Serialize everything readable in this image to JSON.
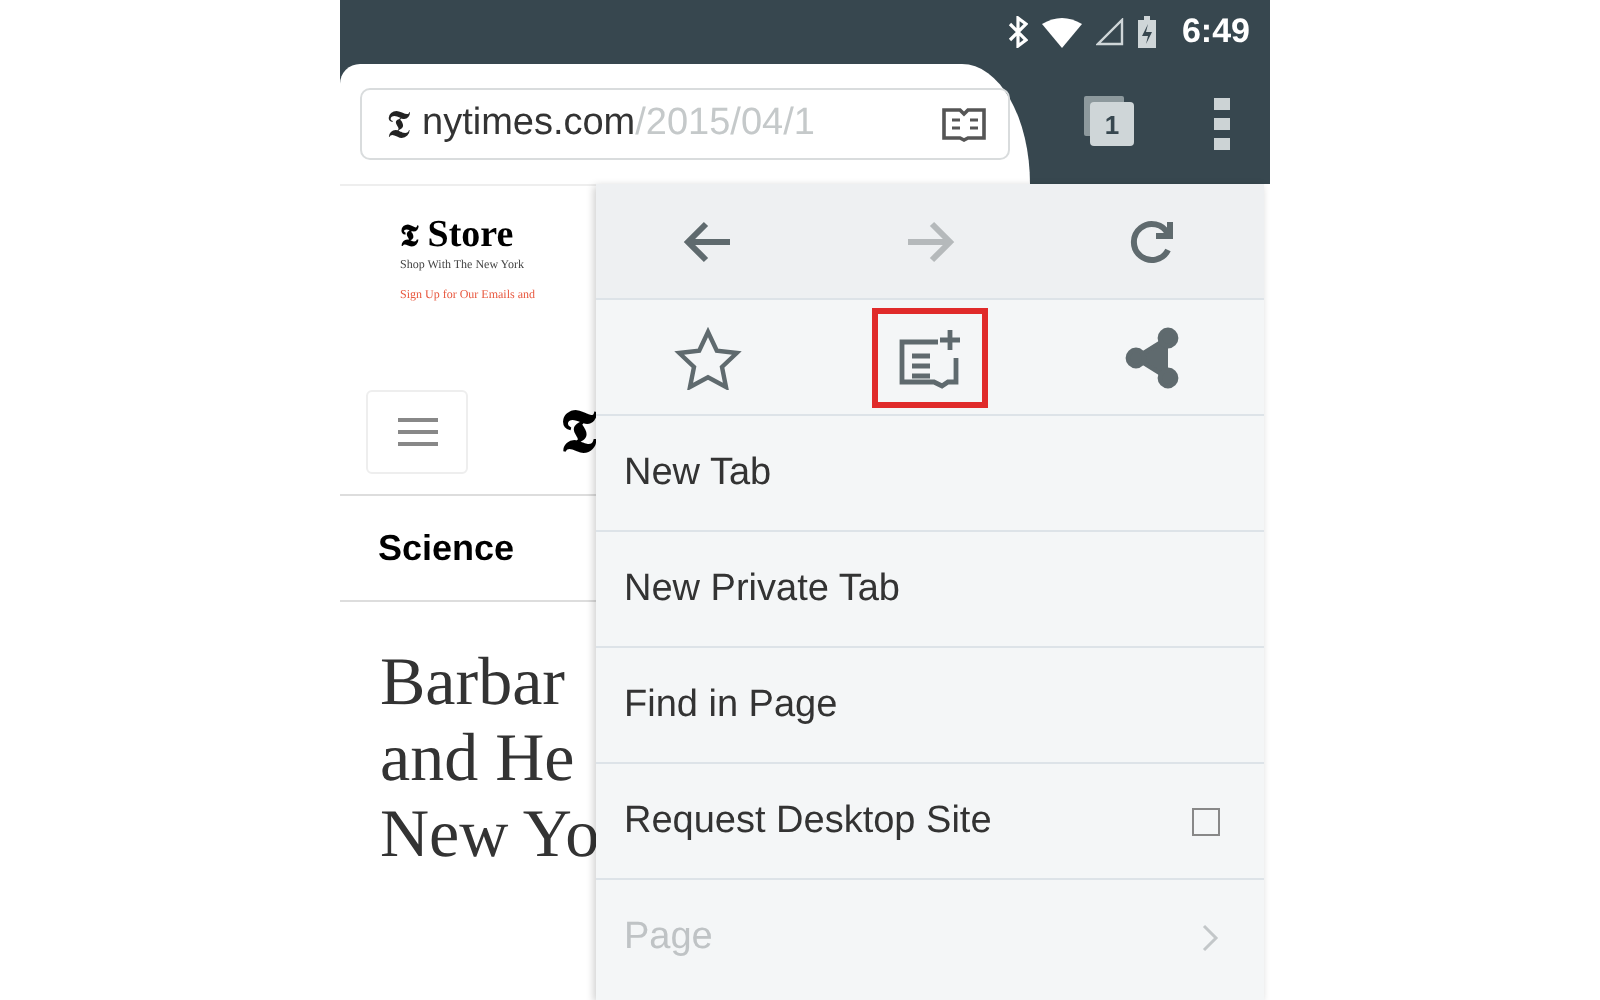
{
  "status_bar": {
    "time": "6:49"
  },
  "address_bar": {
    "logo": "𝕿",
    "domain": "nytimes.com",
    "path": "/2015/04/1"
  },
  "tab_count": "1",
  "page": {
    "store_logo": "𝕿",
    "masthead_logo": "𝕿",
    "store_title": "Store",
    "store_tagline": "Shop With The New York",
    "store_signup": "Sign Up for Our Emails and",
    "section": "Science",
    "headline_lines": [
      "Barbar",
      "and He",
      "New Yo"
    ]
  },
  "menu": {
    "nav_buttons": [
      {
        "kind": "back",
        "disabled": false
      },
      {
        "kind": "forward",
        "disabled": true
      },
      {
        "kind": "reload",
        "disabled": false
      }
    ],
    "actions": [
      {
        "kind": "bookmark",
        "highlighted": false
      },
      {
        "kind": "reading-list",
        "highlighted": true
      },
      {
        "kind": "share",
        "highlighted": false
      }
    ],
    "items": [
      {
        "kind": "plain",
        "label": "New Tab",
        "faded": false
      },
      {
        "kind": "plain",
        "label": "New Private Tab",
        "faded": false
      },
      {
        "kind": "plain",
        "label": "Find in Page",
        "faded": false
      },
      {
        "kind": "checkbox",
        "label": "Request Desktop Site",
        "checked": false,
        "faded": false
      },
      {
        "kind": "submenu",
        "label": "Page",
        "faded": true
      }
    ]
  }
}
